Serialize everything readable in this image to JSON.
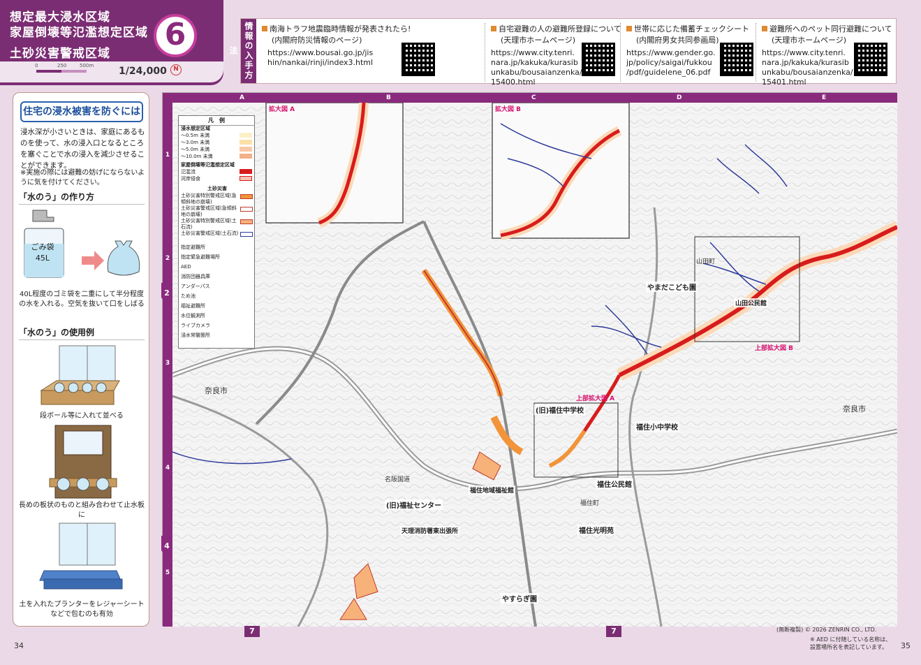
{
  "header": {
    "title_line1": "想定最大浸水区域",
    "title_line2": "家屋倒壊等氾濫想定区域",
    "title_line3": "土砂災害警戒区域",
    "map_number": "6",
    "scale_ticks": [
      "0",
      "250",
      "500m"
    ],
    "scale": "1/24,000",
    "north": "N"
  },
  "info": {
    "label": "情報の入手方法",
    "items": [
      {
        "title": "南海トラフ地震臨時情報が発表されたら!",
        "subtitle": "(内閣府防災情報のページ)",
        "url": "https://www.bousai.go.jp/jis\nhin/nankai/rinji/index3.html"
      },
      {
        "title": "自宅避難の人の避難所登録について",
        "subtitle": "(天理市ホームページ)",
        "url": "https://www.city.tenri.\nnara.jp/kakuka/kurasib\nunkabu/bousaianzenka/\n15400.html"
      },
      {
        "title": "世帯に応じた備蓄チェックシート",
        "subtitle": "(内閣府男女共同参画局)",
        "url": "https://www.gender.go.\njp/policy/saigai/fukkou\n/pdf/guidelene_06.pdf"
      },
      {
        "title": "避難所へのペット同行避難について",
        "subtitle": "(天理市ホームページ)",
        "url": "https://www.city.tenri.\nnara.jp/kakuka/kurasib\nunkabu/bousaianzenka/\n15401.html"
      }
    ]
  },
  "panel": {
    "title": "住宅の浸水被害を防ぐには",
    "intro": "浸水深が小さいときは、家庭にあるものを使って、水の浸入口となるところを塞ぐことで水の浸入を減少させることができます。",
    "note": "※実施の際には避難の妨げにならないように気を付けてください。",
    "how_title": "「水のう」の作り方",
    "bag_label1": "ごみ袋",
    "bag_label2": "45L",
    "how_caption": "40L程度のゴミ袋を二重にして半分程度の水を入れる。空気を抜いて口をしばる",
    "use_title": "「水のう」の使用例",
    "cap1": "段ボール等に入れて並べる",
    "cap2": "長めの板状のものと組み合わせて止水板に",
    "cap3": "土を入れたプランターをレジャーシートなどで包むのも有効"
  },
  "map": {
    "columns": [
      "A",
      "B",
      "C",
      "D",
      "E"
    ],
    "rows": [
      "1",
      "2",
      "3",
      "4",
      "5"
    ],
    "pins": [
      "2",
      "4"
    ],
    "legend": {
      "title": "凡　例",
      "flood_title": "浸水想定区域",
      "flood_rows": [
        "～0.5m 未満",
        "～3.0m 未満",
        "～5.0m 未満",
        "～10.0m 未満"
      ],
      "collapse_title": "家屋倒壊等氾濫想定区域",
      "collapse_rows": [
        "氾濫流",
        "河岸侵食"
      ],
      "sediment_title": "土砂災害",
      "sediment_rows": [
        "土砂災害特別警戒区域(急傾斜地の崩壊)",
        "土砂災害警戒区域(急傾斜地の崩壊)",
        "土砂災害特別警戒区域(土石流)",
        "土砂災害警戒区域(土石流)"
      ],
      "symbols": [
        "指定避難所",
        "指定緊急避難場所",
        "AED",
        "消防団器具庫",
        "アンダーパス",
        "ため池",
        "福祉避難所",
        "水位観測所",
        "ライブカメラ",
        "浸水常襲箇所"
      ]
    },
    "insets": [
      "拡大図 A",
      "拡大図 B",
      "上部拡大図 B",
      "上部拡大図 A"
    ],
    "labels": [
      "福住小中学校",
      "(旧)福住中学校",
      "福住公民館",
      "やまだこども園",
      "(旧)福祉センター",
      "福住光明苑",
      "やすらぎ園",
      "天理消防署東出張所",
      "福住地域福祉館",
      "山田公民館"
    ],
    "places": [
      "奈良市",
      "奈良市",
      "山田町",
      "福住町",
      "名阪国道"
    ]
  },
  "footer": {
    "credit": "(無断複製) © 2026 ZENRIN CO., LTD.",
    "note": "※ AED に付随している名称は、設置場所名を表記しています。",
    "page_left": "34",
    "page_right": "35",
    "tab": "7"
  },
  "colors": {
    "brand": "#7b2d73",
    "accent": "#c63d9d",
    "flood_red": "#d81c1c",
    "sediment_orange": "#f2943a",
    "stream_blue": "#2d3a9b"
  }
}
